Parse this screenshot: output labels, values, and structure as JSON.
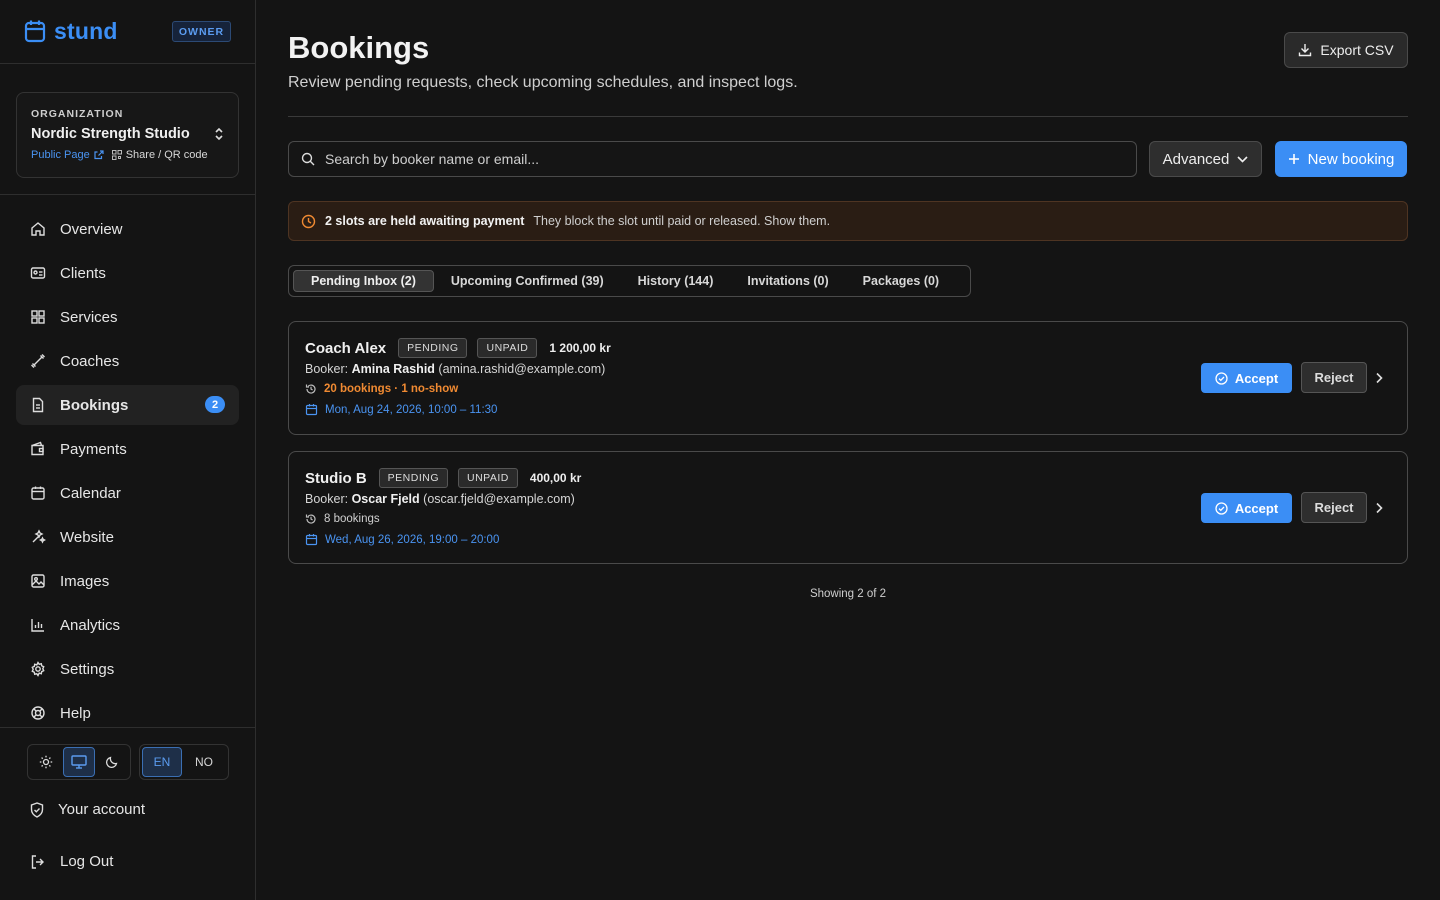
{
  "brand": {
    "name": "stund",
    "role_badge": "OWNER"
  },
  "organization": {
    "label": "ORGANIZATION",
    "name": "Nordic Strength Studio",
    "public_page": "Public Page",
    "share": "Share / QR code"
  },
  "nav": [
    {
      "label": "Overview",
      "icon": "home-icon"
    },
    {
      "label": "Clients",
      "icon": "id-card-icon"
    },
    {
      "label": "Services",
      "icon": "grid-icon"
    },
    {
      "label": "Coaches",
      "icon": "dumbbell-icon"
    },
    {
      "label": "Bookings",
      "icon": "document-icon",
      "badge": "2",
      "active": true
    },
    {
      "label": "Payments",
      "icon": "wallet-icon"
    },
    {
      "label": "Calendar",
      "icon": "calendar-icon"
    },
    {
      "label": "Website",
      "icon": "sparkles-icon"
    },
    {
      "label": "Images",
      "icon": "image-icon"
    },
    {
      "label": "Analytics",
      "icon": "bar-chart-icon"
    },
    {
      "label": "Settings",
      "icon": "gear-icon"
    },
    {
      "label": "Help",
      "icon": "lifebuoy-icon"
    }
  ],
  "theme": {
    "options": [
      "light",
      "system",
      "dark"
    ],
    "selected": "system"
  },
  "language": {
    "options": [
      "EN",
      "NO"
    ],
    "selected": "EN"
  },
  "footer": {
    "account": "Your account",
    "logout": "Log Out"
  },
  "header": {
    "title": "Bookings",
    "subtitle": "Review pending requests, check upcoming schedules, and inspect logs.",
    "export_label": "Export CSV"
  },
  "toolbar": {
    "search_placeholder": "Search by booker name or email...",
    "advanced_label": "Advanced",
    "new_booking_label": "New booking"
  },
  "alert": {
    "strong": "2 slots are held awaiting payment",
    "rest": "They block the slot until paid or released. Show them."
  },
  "tabs": [
    {
      "label": "Pending Inbox (2)",
      "active": true
    },
    {
      "label": "Upcoming Confirmed (39)"
    },
    {
      "label": "History (144)"
    },
    {
      "label": "Invitations (0)"
    },
    {
      "label": "Packages (0)"
    }
  ],
  "bookings": [
    {
      "title": "Coach Alex",
      "status": "PENDING",
      "payment": "UNPAID",
      "price": "1 200,00 kr",
      "booker_prefix": "Booker:",
      "booker_name": "Amina Rashid",
      "booker_email": "(amina.rashid@example.com)",
      "stats": "20 bookings · 1 no-show",
      "stats_warn": true,
      "when": "Mon, Aug 24, 2026, 10:00 – 11:30",
      "accept": "Accept",
      "reject": "Reject"
    },
    {
      "title": "Studio B",
      "status": "PENDING",
      "payment": "UNPAID",
      "price": "400,00 kr",
      "booker_prefix": "Booker:",
      "booker_name": "Oscar Fjeld",
      "booker_email": "(oscar.fjeld@example.com)",
      "stats": "8 bookings",
      "stats_warn": false,
      "when": "Wed, Aug 26, 2026, 19:00 – 20:00",
      "accept": "Accept",
      "reject": "Reject"
    }
  ],
  "showing": "Showing 2 of 2",
  "colors": {
    "accent": "#3b8ef5",
    "warning": "#f08a32",
    "background": "#141414"
  }
}
